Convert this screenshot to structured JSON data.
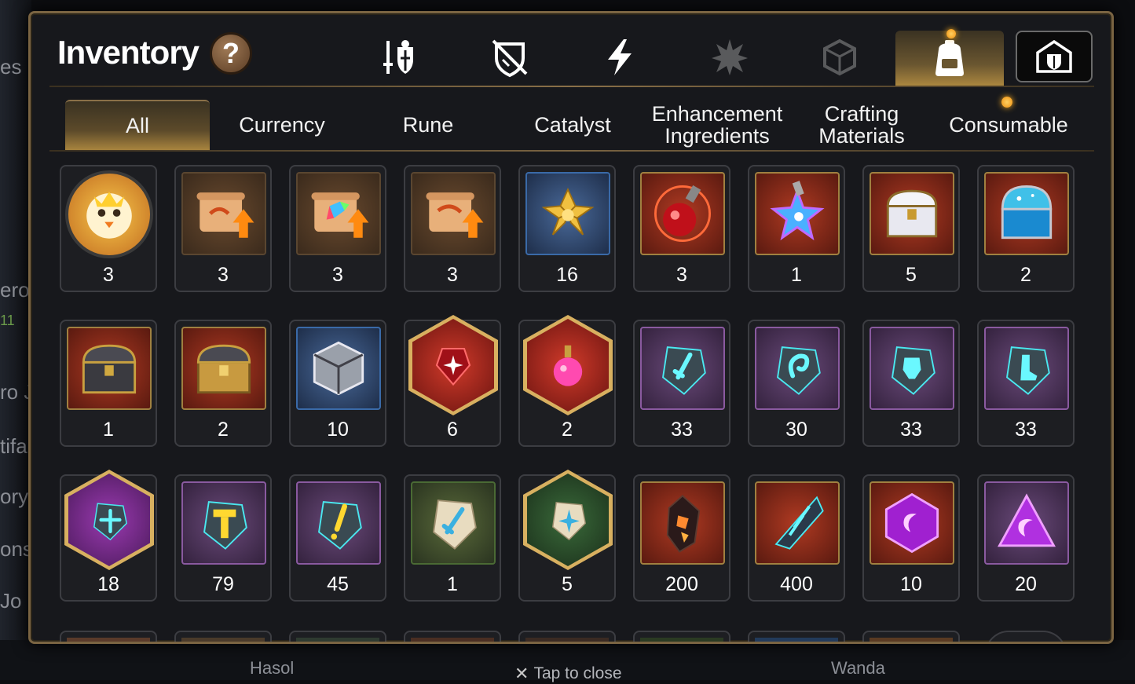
{
  "background": {
    "left_fragments": [
      "es",
      "ero",
      "11",
      "ro J",
      "tifa",
      "ory",
      "ons",
      "Jo"
    ],
    "bottom_names": [
      "Hasol",
      "Wanda"
    ],
    "close_hint": "Tap to close"
  },
  "header": {
    "title": "Inventory",
    "help_label": "?"
  },
  "categories": [
    {
      "name": "equipment",
      "icon": "sword-shield-icon",
      "active": false
    },
    {
      "name": "unequipped",
      "icon": "broken-shield-icon",
      "active": false
    },
    {
      "name": "skill",
      "icon": "lightning-icon",
      "active": false
    },
    {
      "name": "burst",
      "icon": "burst-icon",
      "active": false
    },
    {
      "name": "material-cube",
      "icon": "cube-icon",
      "active": false
    },
    {
      "name": "bag",
      "icon": "backpack-icon",
      "active": true
    }
  ],
  "tabs": [
    {
      "label": "All",
      "active": true
    },
    {
      "label": "Currency",
      "active": false
    },
    {
      "label": "Rune",
      "active": false
    },
    {
      "label": "Catalyst",
      "active": false
    },
    {
      "label": "Enhancement Ingredients",
      "active": false
    },
    {
      "label": "Crafting Materials",
      "active": false
    },
    {
      "label": "Consumable",
      "active": false
    }
  ],
  "items": [
    {
      "icon": "chick-coin-icon",
      "count": "3"
    },
    {
      "icon": "scroll-upgrade-icon",
      "count": "3"
    },
    {
      "icon": "rainbow-scroll-icon",
      "count": "3"
    },
    {
      "icon": "scroll-upgrade-icon",
      "count": "3"
    },
    {
      "icon": "gold-flower-icon",
      "count": "16"
    },
    {
      "icon": "red-potion-icon",
      "count": "3"
    },
    {
      "icon": "star-potion-icon",
      "count": "1"
    },
    {
      "icon": "silver-chest-icon",
      "count": "5"
    },
    {
      "icon": "blue-chest-icon",
      "count": "2"
    },
    {
      "icon": "dark-chest-icon",
      "count": "1"
    },
    {
      "icon": "gold-chest-icon",
      "count": "2"
    },
    {
      "icon": "silver-cube-icon",
      "count": "10"
    },
    {
      "icon": "red-gem-icon",
      "count": "6"
    },
    {
      "icon": "pink-potion-icon",
      "count": "2"
    },
    {
      "icon": "sword-rune-icon",
      "count": "33"
    },
    {
      "icon": "spiral-rune-icon",
      "count": "30"
    },
    {
      "icon": "armor-rune-icon",
      "count": "33"
    },
    {
      "icon": "boot-rune-icon",
      "count": "33"
    },
    {
      "icon": "cross-rune-icon",
      "count": "18"
    },
    {
      "icon": "hammer-rune-icon",
      "count": "79"
    },
    {
      "icon": "gold-rune-icon",
      "count": "45"
    },
    {
      "icon": "stone-sword-rune-icon",
      "count": "1"
    },
    {
      "icon": "stone-star-rune-icon",
      "count": "5"
    },
    {
      "icon": "fire-crystal-icon",
      "count": "200"
    },
    {
      "icon": "ice-shard-icon",
      "count": "400"
    },
    {
      "icon": "moon-gem-icon",
      "count": "10"
    },
    {
      "icon": "moon-prism-icon",
      "count": "20"
    }
  ]
}
